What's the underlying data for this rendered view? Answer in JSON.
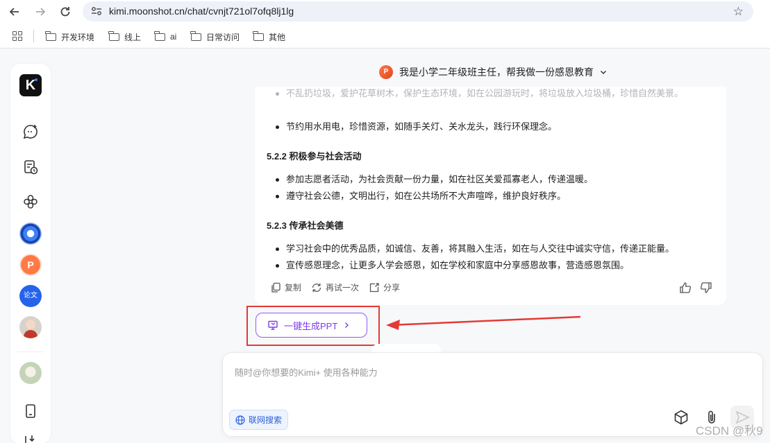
{
  "browser": {
    "url": "kimi.moonshot.cn/chat/cvnjt721ol7ofq8lj1lg",
    "bookmarks": [
      "开发环境",
      "线上",
      "ai",
      "日常访问",
      "其他"
    ]
  },
  "sidebar": {
    "logo": "K",
    "items": [
      {
        "icon": "new-chat-icon"
      },
      {
        "icon": "history-icon"
      },
      {
        "icon": "explore-icon"
      },
      {
        "icon": "kimi-avatar"
      },
      {
        "icon": "ppt-assistant-avatar",
        "label": "P"
      },
      {
        "icon": "paper-assistant-avatar",
        "label": "论文"
      },
      {
        "icon": "user-avatar"
      },
      {
        "icon": "user-avatar-2"
      },
      {
        "icon": "mobile-icon"
      },
      {
        "icon": "download-icon"
      }
    ]
  },
  "chat": {
    "title": "我是小学二年级班主任，帮我做一份感恩教育",
    "title_badge": "P"
  },
  "message": {
    "faded_bullet": "不乱扔垃圾，爱护花草树木，保护生态环境，如在公园游玩时，将垃圾放入垃圾桶，珍惜自然美景。",
    "bullet_1": "节约用水用电，珍惜资源，如随手关灯、关水龙头，践行环保理念。",
    "section_2": "5.2.2 积极参与社会活动",
    "bullet_2": "参加志愿者活动，为社会贡献一份力量，如在社区关爱孤寡老人，传递温暖。",
    "bullet_3": "遵守社会公德，文明出行，如在公共场所不大声喧哗，维护良好秩序。",
    "section_3": "5.2.3 传承社会美德",
    "bullet_4": "学习社会中的优秀品质，如诚信、友善，将其融入生活，如在与人交往中诚实守信，传递正能量。",
    "bullet_5": "宣传感恩理念，让更多人学会感恩，如在学校和家庭中分享感恩故事，营造感恩氛围。",
    "actions": {
      "copy": "复制",
      "retry": "再试一次",
      "share": "分享"
    }
  },
  "ppt_button": {
    "label": "一键生成PPT"
  },
  "input": {
    "placeholder": "随时@你想要的Kimi+ 使用各种能力",
    "search_chip": "联网搜索"
  },
  "watermark": "CSDN @秋9",
  "colors": {
    "accent": "#7c3aed",
    "highlight": "#e53935",
    "chip": "#2f5fd0"
  }
}
